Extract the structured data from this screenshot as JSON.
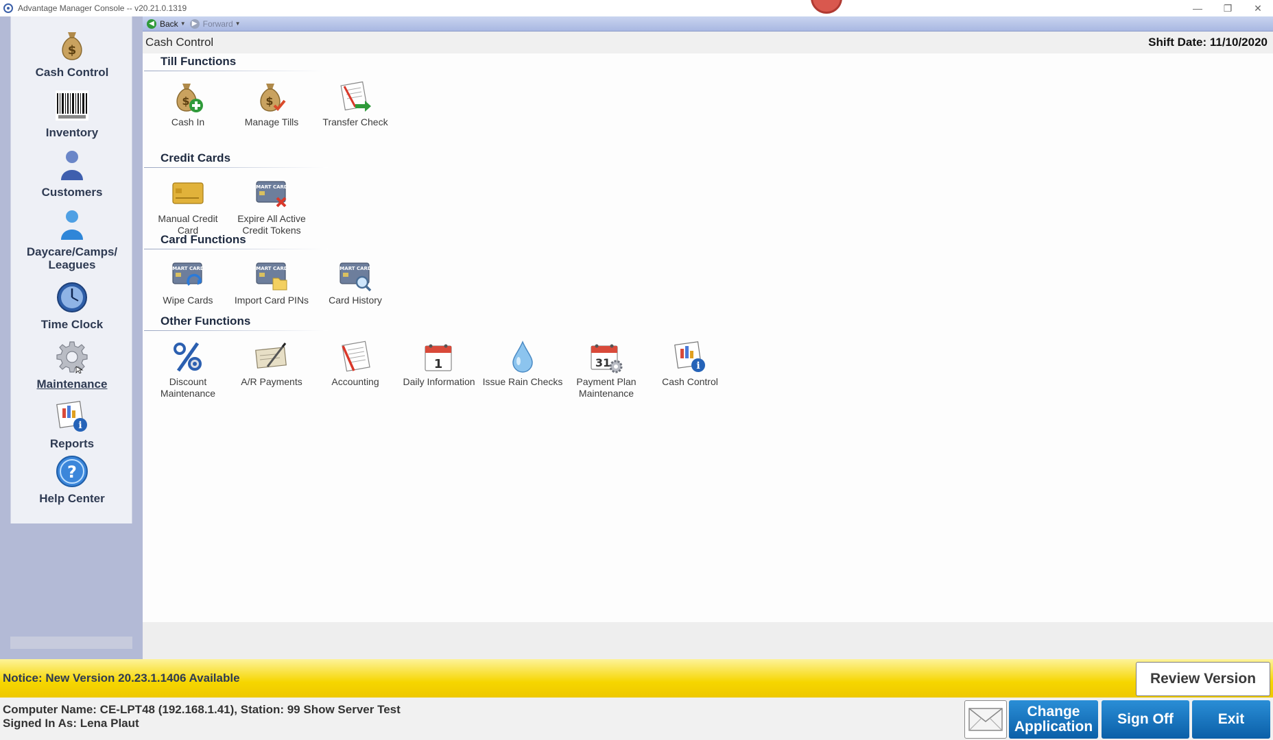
{
  "window": {
    "title": "Advantage Manager Console -- v20.21.0.1319",
    "controls": [
      "—",
      "❐",
      "✕"
    ]
  },
  "sidebar": {
    "items": [
      {
        "label": "Cash Control",
        "icon": "money-bag-icon"
      },
      {
        "label": "Inventory",
        "icon": "barcode-icon"
      },
      {
        "label": "Customers",
        "icon": "person-icon"
      },
      {
        "label": "Daycare/Camps/ Leagues",
        "icon": "person-blue-icon"
      },
      {
        "label": "Time Clock",
        "icon": "clock-icon"
      },
      {
        "label": "Maintenance",
        "icon": "gear-icon"
      },
      {
        "label": "Reports",
        "icon": "report-icon"
      },
      {
        "label": "Help Center",
        "icon": "help-icon"
      }
    ]
  },
  "navbar": {
    "back_label": "Back",
    "forward_label": "Forward"
  },
  "page": {
    "title": "Cash Control",
    "shift_date": "Shift Date: 11/10/2020"
  },
  "sections": [
    {
      "title": "Till Functions",
      "tiles": [
        {
          "label": "Cash In",
          "icon": "money-bag-plus-icon"
        },
        {
          "label": "Manage Tills",
          "icon": "money-bag-check-icon"
        },
        {
          "label": "Transfer Check",
          "icon": "check-transfer-icon"
        }
      ]
    },
    {
      "title": "Credit Cards",
      "tiles": [
        {
          "label": "Manual Credit Card",
          "icon": "credit-card-icon"
        },
        {
          "label": "Expire All Active Credit Tokens",
          "icon": "card-expire-icon"
        }
      ]
    },
    {
      "title": "Card Functions",
      "tiles": [
        {
          "label": "Wipe Cards",
          "icon": "card-wipe-icon"
        },
        {
          "label": "Import Card PINs",
          "icon": "card-import-icon"
        },
        {
          "label": "Card History",
          "icon": "card-history-icon"
        }
      ]
    },
    {
      "title": "Other Functions",
      "tiles": [
        {
          "label": "Discount Maintenance",
          "icon": "percent-icon"
        },
        {
          "label": "A/R Payments",
          "icon": "check-pen-icon"
        },
        {
          "label": "Accounting",
          "icon": "ledger-icon"
        },
        {
          "label": "Daily Information",
          "icon": "calendar-icon"
        },
        {
          "label": "Issue Rain Checks",
          "icon": "raindrop-icon"
        },
        {
          "label": "Payment Plan Maintenance",
          "icon": "calendar-gear-icon"
        },
        {
          "label": "Cash Control",
          "icon": "report-icon"
        }
      ]
    }
  ],
  "calendar_digits": {
    "daily": "1",
    "payment_plan": "31"
  },
  "card_text": "SMART CARD",
  "notice": {
    "text": "Notice: New Version 20.23.1.1406 Available",
    "review_label": "Review Version"
  },
  "status": {
    "computer_line": "Computer Name: CE-LPT48 (192.168.1.41), Station: 99 Show Server Test",
    "user_line": "Signed In As: Lena Plaut"
  },
  "actions": {
    "change_app_label": "Change Application",
    "sign_off_label": "Sign Off",
    "exit_label": "Exit"
  },
  "colors": {
    "accent_blue": "#0b5fa8",
    "notice_yellow": "#f6d600",
    "sidebar_bg": "#b3bad6"
  }
}
